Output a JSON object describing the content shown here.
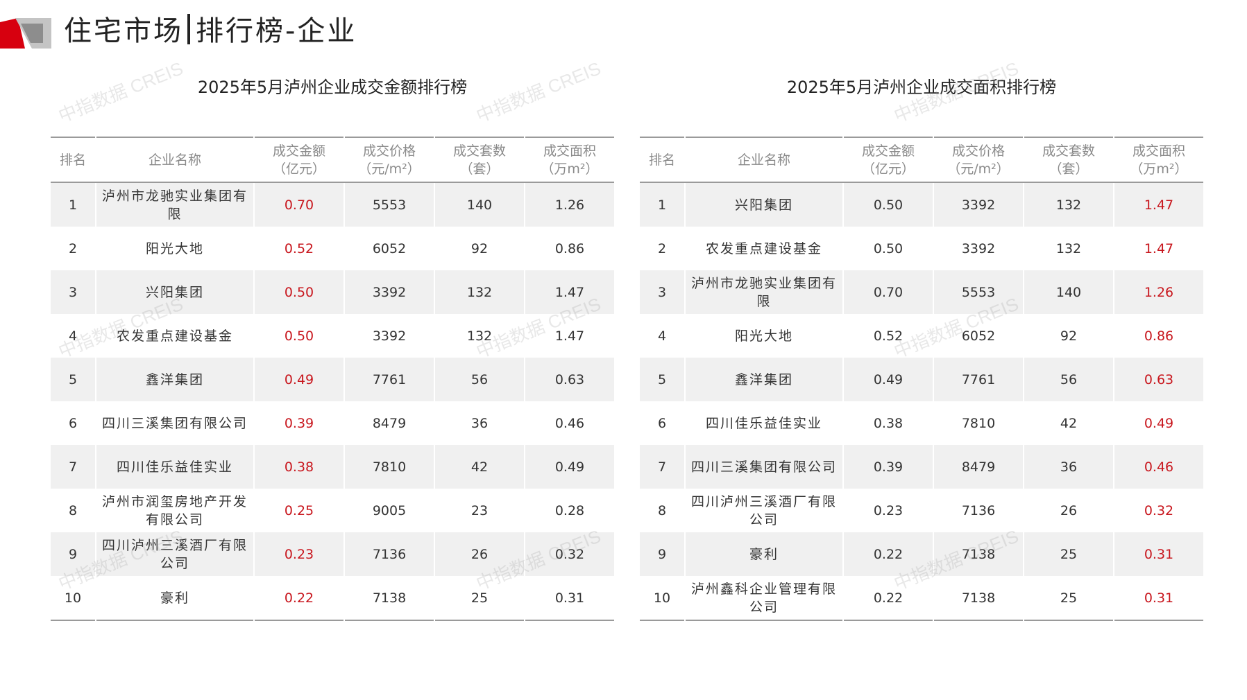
{
  "header": {
    "title_main": "住宅市场",
    "title_sub": "排行榜-企业"
  },
  "colors": {
    "accent_red": "#c8161d",
    "logo_red": "#d7000f",
    "logo_gray": "#b5b5b5"
  },
  "watermark": "中指数据 CREIS",
  "columns": [
    {
      "line1": "排名",
      "line2": ""
    },
    {
      "line1": "企业名称",
      "line2": ""
    },
    {
      "line1": "成交金额",
      "line2": "（亿元）"
    },
    {
      "line1": "成交价格",
      "line2": "（元/m²）"
    },
    {
      "line1": "成交套数",
      "line2": "（套）"
    },
    {
      "line1": "成交面积",
      "line2": "（万m²）"
    }
  ],
  "left_table": {
    "title": "2025年5月泸州企业成交金额排行榜",
    "rows": [
      {
        "rank": "1",
        "name": "泸州市龙驰实业集团有限",
        "amount": "0.70",
        "price": "5553",
        "units": "140",
        "area": "1.26"
      },
      {
        "rank": "2",
        "name": "阳光大地",
        "amount": "0.52",
        "price": "6052",
        "units": "92",
        "area": "0.86"
      },
      {
        "rank": "3",
        "name": "兴阳集团",
        "amount": "0.50",
        "price": "3392",
        "units": "132",
        "area": "1.47"
      },
      {
        "rank": "4",
        "name": "农发重点建设基金",
        "amount": "0.50",
        "price": "3392",
        "units": "132",
        "area": "1.47"
      },
      {
        "rank": "5",
        "name": "鑫洋集团",
        "amount": "0.49",
        "price": "7761",
        "units": "56",
        "area": "0.63"
      },
      {
        "rank": "6",
        "name": "四川三溪集团有限公司",
        "amount": "0.39",
        "price": "8479",
        "units": "36",
        "area": "0.46"
      },
      {
        "rank": "7",
        "name": "四川佳乐益佳实业",
        "amount": "0.38",
        "price": "7810",
        "units": "42",
        "area": "0.49"
      },
      {
        "rank": "8",
        "name": "泸州市润玺房地产开发有限公司",
        "amount": "0.25",
        "price": "9005",
        "units": "23",
        "area": "0.28"
      },
      {
        "rank": "9",
        "name": "四川泸州三溪酒厂有限公司",
        "amount": "0.23",
        "price": "7136",
        "units": "26",
        "area": "0.32"
      },
      {
        "rank": "10",
        "name": "豪利",
        "amount": "0.22",
        "price": "7138",
        "units": "25",
        "area": "0.31"
      }
    ]
  },
  "right_table": {
    "title": "2025年5月泸州企业成交面积排行榜",
    "rows": [
      {
        "rank": "1",
        "name": "兴阳集团",
        "amount": "0.50",
        "price": "3392",
        "units": "132",
        "area": "1.47"
      },
      {
        "rank": "2",
        "name": "农发重点建设基金",
        "amount": "0.50",
        "price": "3392",
        "units": "132",
        "area": "1.47"
      },
      {
        "rank": "3",
        "name": "泸州市龙驰实业集团有限",
        "amount": "0.70",
        "price": "5553",
        "units": "140",
        "area": "1.26"
      },
      {
        "rank": "4",
        "name": "阳光大地",
        "amount": "0.52",
        "price": "6052",
        "units": "92",
        "area": "0.86"
      },
      {
        "rank": "5",
        "name": "鑫洋集团",
        "amount": "0.49",
        "price": "7761",
        "units": "56",
        "area": "0.63"
      },
      {
        "rank": "6",
        "name": "四川佳乐益佳实业",
        "amount": "0.38",
        "price": "7810",
        "units": "42",
        "area": "0.49"
      },
      {
        "rank": "7",
        "name": "四川三溪集团有限公司",
        "amount": "0.39",
        "price": "8479",
        "units": "36",
        "area": "0.46"
      },
      {
        "rank": "8",
        "name": "四川泸州三溪酒厂有限公司",
        "amount": "0.23",
        "price": "7136",
        "units": "26",
        "area": "0.32"
      },
      {
        "rank": "9",
        "name": "豪利",
        "amount": "0.22",
        "price": "7138",
        "units": "25",
        "area": "0.31"
      },
      {
        "rank": "10",
        "name": "泸州鑫科企业管理有限公司",
        "amount": "0.22",
        "price": "7138",
        "units": "25",
        "area": "0.31"
      }
    ]
  }
}
